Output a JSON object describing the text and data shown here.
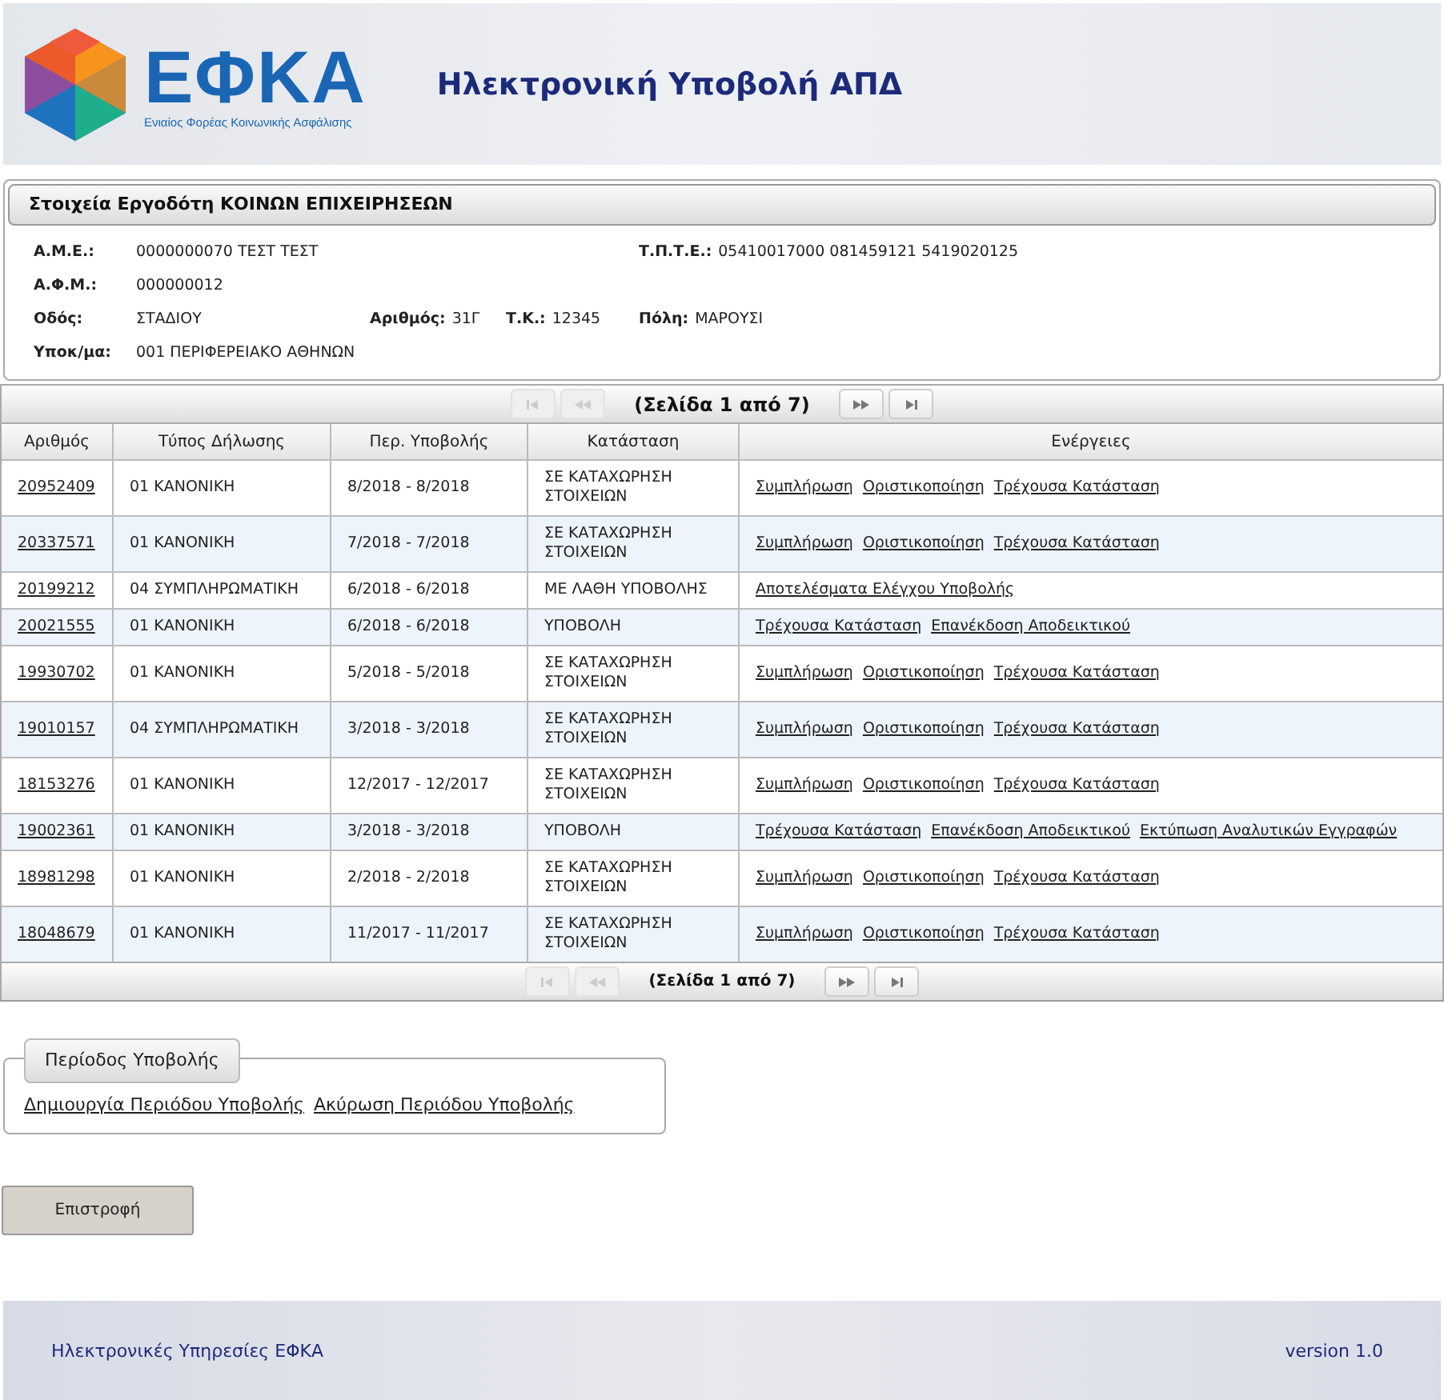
{
  "header": {
    "logo_text": "ΕΦΚΑ",
    "logo_subtitle": "Ενιαίος Φορέας Κοινωνικής Ασφάλισης",
    "title": "Ηλεκτρονική Υποβολή ΑΠΔ"
  },
  "employer": {
    "title": "Στοιχεία Εργοδότη ΚΟΙΝΩΝ ΕΠΙΧΕΙΡΗΣΕΩΝ",
    "rows": [
      [
        {
          "label": "Α.Μ.Ε.:",
          "value": "0000000070 ΤΕΣΤ ΤΕΣΤ"
        },
        null,
        null,
        {
          "label": "Τ.Π.Τ.Ε.:",
          "value": "05410017000 081459121 5419020125"
        }
      ],
      [
        {
          "label": "Α.Φ.Μ.:",
          "value": "000000012"
        }
      ],
      [
        {
          "label": "Οδός:",
          "value": "ΣΤΑΔΙΟΥ"
        },
        {
          "label": "Αριθμός:",
          "value": "31Γ"
        },
        {
          "label": "Τ.Κ.:",
          "value": "12345"
        },
        {
          "label": "Πόλη:",
          "value": "ΜΑΡΟΥΣΙ"
        }
      ],
      [
        {
          "label": "Υποκ/μα:",
          "value": "001 ΠΕΡΙΦΕΡΕΙΑΚΟ ΑΘΗΝΩΝ"
        }
      ]
    ]
  },
  "pager_top": {
    "text": "(Σελίδα 1 από 7)",
    "buttons": [
      {
        "kind": "first",
        "disabled": true
      },
      {
        "kind": "prev",
        "disabled": true
      },
      {
        "kind": "next",
        "disabled": false
      },
      {
        "kind": "last",
        "disabled": false
      }
    ]
  },
  "table": {
    "columns": [
      "Αριθμός",
      "Τύπος Δήλωσης",
      "Περ. Υποβολής",
      "Κατάσταση",
      "Ενέργειες"
    ],
    "rows": [
      {
        "number": "20952409",
        "type": "01 ΚΑΝΟΝΙΚΗ",
        "period": "8/2018 - 8/2018",
        "status": "ΣΕ ΚΑΤΑΧΩΡΗΣΗ ΣΤΟΙΧΕΙΩΝ",
        "actions": [
          "Συμπλήρωση",
          "Οριστικοποίηση",
          "Τρέχουσα Κατάσταση"
        ]
      },
      {
        "number": "20337571",
        "type": "01 ΚΑΝΟΝΙΚΗ",
        "period": "7/2018 - 7/2018",
        "status": "ΣΕ ΚΑΤΑΧΩΡΗΣΗ ΣΤΟΙΧΕΙΩΝ",
        "actions": [
          "Συμπλήρωση",
          "Οριστικοποίηση",
          "Τρέχουσα Κατάσταση"
        ]
      },
      {
        "number": "20199212",
        "type": "04 ΣΥΜΠΛΗΡΩΜΑΤΙΚΗ",
        "period": "6/2018 - 6/2018",
        "status": "ΜΕ ΛΑΘΗ ΥΠΟΒΟΛΗΣ",
        "actions": [
          "Αποτελέσματα Ελέγχου Υποβολής"
        ]
      },
      {
        "number": "20021555",
        "type": "01 ΚΑΝΟΝΙΚΗ",
        "period": "6/2018 - 6/2018",
        "status": "ΥΠΟΒΟΛΗ",
        "actions": [
          "Τρέχουσα Κατάσταση",
          "Επανέκδοση Αποδεικτικού"
        ]
      },
      {
        "number": "19930702",
        "type": "01 ΚΑΝΟΝΙΚΗ",
        "period": "5/2018 - 5/2018",
        "status": "ΣΕ ΚΑΤΑΧΩΡΗΣΗ ΣΤΟΙΧΕΙΩΝ",
        "actions": [
          "Συμπλήρωση",
          "Οριστικοποίηση",
          "Τρέχουσα Κατάσταση"
        ]
      },
      {
        "number": "19010157",
        "type": "04 ΣΥΜΠΛΗΡΩΜΑΤΙΚΗ",
        "period": "3/2018 - 3/2018",
        "status": "ΣΕ ΚΑΤΑΧΩΡΗΣΗ ΣΤΟΙΧΕΙΩΝ",
        "actions": [
          "Συμπλήρωση",
          "Οριστικοποίηση",
          "Τρέχουσα Κατάσταση"
        ]
      },
      {
        "number": "18153276",
        "type": "01 ΚΑΝΟΝΙΚΗ",
        "period": "12/2017 - 12/2017",
        "status": "ΣΕ ΚΑΤΑΧΩΡΗΣΗ ΣΤΟΙΧΕΙΩΝ",
        "actions": [
          "Συμπλήρωση",
          "Οριστικοποίηση",
          "Τρέχουσα Κατάσταση"
        ]
      },
      {
        "number": "19002361",
        "type": "01 ΚΑΝΟΝΙΚΗ",
        "period": "3/2018 - 3/2018",
        "status": "ΥΠΟΒΟΛΗ",
        "actions": [
          "Τρέχουσα Κατάσταση",
          "Επανέκδοση Αποδεικτικού",
          "Εκτύπωση Αναλυτικών Εγγραφών"
        ]
      },
      {
        "number": "18981298",
        "type": "01 ΚΑΝΟΝΙΚΗ",
        "period": "2/2018 - 2/2018",
        "status": "ΣΕ ΚΑΤΑΧΩΡΗΣΗ ΣΤΟΙΧΕΙΩΝ",
        "actions": [
          "Συμπλήρωση",
          "Οριστικοποίηση",
          "Τρέχουσα Κατάσταση"
        ]
      },
      {
        "number": "18048679",
        "type": "01 ΚΑΝΟΝΙΚΗ",
        "period": "11/2017 - 11/2017",
        "status": "ΣΕ ΚΑΤΑΧΩΡΗΣΗ ΣΤΟΙΧΕΙΩΝ",
        "actions": [
          "Συμπλήρωση",
          "Οριστικοποίηση",
          "Τρέχουσα Κατάσταση"
        ]
      }
    ]
  },
  "pager_bottom": {
    "text": "(Σελίδα 1 από 7)",
    "buttons": [
      {
        "kind": "first",
        "disabled": true
      },
      {
        "kind": "prev",
        "disabled": true
      },
      {
        "kind": "next",
        "disabled": false
      },
      {
        "kind": "last",
        "disabled": false
      }
    ]
  },
  "period_box": {
    "legend": "Περίοδος Υποβολής",
    "links": [
      "Δημιουργία Περιόδου Υποβολής",
      "Ακύρωση Περιόδου Υποβολής"
    ]
  },
  "back_button": "Επιστροφή",
  "footer": {
    "left": "Ηλεκτρονικές Υπηρεσίες ΕΦΚΑ",
    "right": "version 1.0"
  }
}
